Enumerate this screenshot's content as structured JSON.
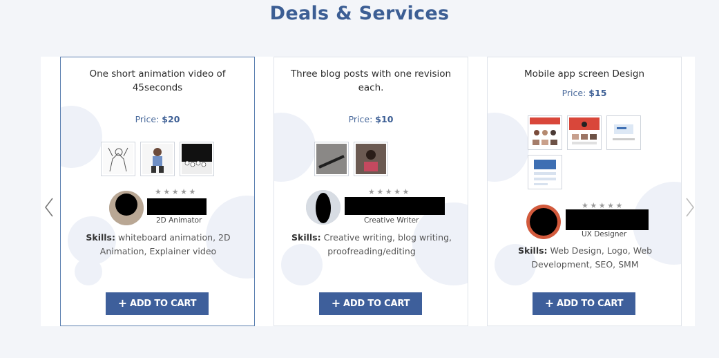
{
  "section": {
    "title": "Deals & Services"
  },
  "colors": {
    "accent": "#3e5f9b",
    "heading": "#3c5e94",
    "background": "#f3f5f9"
  },
  "cards": [
    {
      "title": "One short animation video of 45seconds",
      "price_label": "Price:",
      "price_value": "$20",
      "rating": {
        "stars": 5,
        "filled": 0
      },
      "role": "2D Animator",
      "skills_label": "Skills:",
      "skills": "whiteboard animation, 2D Animation, Explainer video",
      "cart_label": "ADD TO CART",
      "thumbnails": 3
    },
    {
      "title": "Three blog posts with one revision each.",
      "price_label": "Price:",
      "price_value": "$10",
      "rating": {
        "stars": 5,
        "filled": 0
      },
      "role": "Creative Writer",
      "skills_label": "Skills:",
      "skills": "Creative writing, blog writing, proofreading/editing",
      "cart_label": "ADD TO CART",
      "thumbnails": 2
    },
    {
      "title": "Mobile app screen Design",
      "price_label": "Price:",
      "price_value": "$15",
      "rating": {
        "stars": 5,
        "filled": 0
      },
      "role": "UX Designer",
      "skills_label": "Skills:",
      "skills": "Web Design, Logo, Web Development, SEO, SMM",
      "cart_label": "ADD TO CART",
      "thumbnails": 4
    }
  ],
  "stars_text": "★★★★★",
  "icons": {
    "prev": "chevron-left-icon",
    "next": "chevron-right-icon",
    "plus": "plus-icon",
    "star": "star-icon"
  }
}
